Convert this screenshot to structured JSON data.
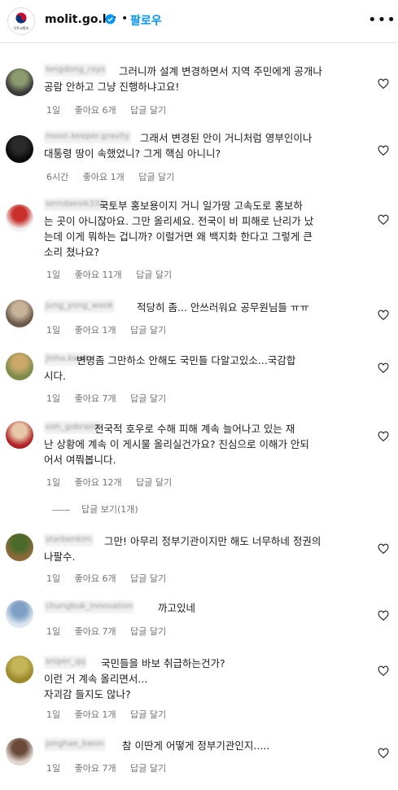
{
  "header": {
    "logo_text": "국토교통부",
    "account": "molit.go.kr",
    "separator": "•",
    "follow": "팔로우",
    "more": "•••"
  },
  "comments": [
    {
      "username": "longdong_rays",
      "text": "그러니까 설계 변경하면서 지역 주민에게 공개나\n공람 안하고 그냥 진행하냐고요!",
      "time": "1일",
      "likes": "좋아요 6개",
      "reply": "답글 달기",
      "colors": [
        "#3a3a3a",
        "#8a9c6e"
      ]
    },
    {
      "username": "moon.keeper.gravity",
      "text": "그래서 변경된 안이 거니처럼 영부인이나\n대통령 땅이 속했었니? 그게 핵심 아니니?",
      "time": "6시간",
      "likes": "좋아요 1개",
      "reply": "답글 달기",
      "colors": [
        "#0a0a0a",
        "#2a2a2a"
      ]
    },
    {
      "username": "semdaesik333",
      "text": "국토부 홍보용이지 거니 일가땅 고속도로 홍보하\n는 곳이 아니잖아요. 그만 올리세요. 전국이 비 피해로 난리가 났\n는데 이게 뭐하는 겁니까? 이럴거면 왜 백지화 한다고 그렇게 큰\n소리 쳤나요?",
      "time": "1일",
      "likes": "좋아요 11개",
      "reply": "답글 달기",
      "colors": [
        "#f3f3f3",
        "#c9302c"
      ]
    },
    {
      "username": "jung_yong_wook",
      "text": "적당히 좀... 안쓰러워요 공무원님들 ㅠㅠ",
      "time": "1일",
      "likes": "좋아요 1개",
      "reply": "답글 달기",
      "colors": [
        "#6b5a48",
        "#c7b39a"
      ]
    },
    {
      "username": "jinho.kwak",
      "text": "변명좀 그만하소 안해도 국민들 다알고있소...국감합\n시다.",
      "time": "1일",
      "likes": "좋아요 7개",
      "reply": "답글 달기",
      "colors": [
        "#7a8b4a",
        "#c9a86a"
      ]
    },
    {
      "username": "ooh_gobrains",
      "text": "전국적 호우로 수해 피해 계속 늘어나고 있는 재\n난 상황에 계속 이 게시물 올리실건가요? 진심으로 이해가 안되\n어서 여쭤봅니다.",
      "time": "1일",
      "likes": "좋아요 12개",
      "reply": "답글 달기",
      "colors": [
        "#b3202a",
        "#e6c9a8"
      ]
    },
    {
      "username": "starbenkim",
      "text": "그만! 아무리 정부기관이지만 해도 너무하네 정권의\n나팔수.",
      "time": "1일",
      "likes": "좋아요 6개",
      "reply": "답글 달기",
      "colors": [
        "#8b6a3a",
        "#4a6b2a"
      ]
    },
    {
      "username": "chungbuk_innovation",
      "text": "까고있네",
      "time": "1일",
      "likes": "좋아요 7개",
      "reply": "답글 달기",
      "colors": [
        "#dce6f0",
        "#7f9fc4"
      ]
    },
    {
      "username": "sniper_qq",
      "text": "국민들을 바보 취급하는건가?\n이런 거 계속 올리면서...\n자괴감 들지도 않나?",
      "time": "1일",
      "likes": "좋아요 1개",
      "reply": "답글 달기",
      "colors": [
        "#9a8a2a",
        "#c4b45a"
      ]
    },
    {
      "username": "jonghae_kwon",
      "text": "참 이딴게 어떻게 정부기관인지.....",
      "time": "1일",
      "likes": "좋아요 7개",
      "reply": "답글 달기",
      "colors": [
        "#e0d6cf",
        "#6b4a3a"
      ]
    }
  ],
  "view_replies": "답글 보기(1개)"
}
